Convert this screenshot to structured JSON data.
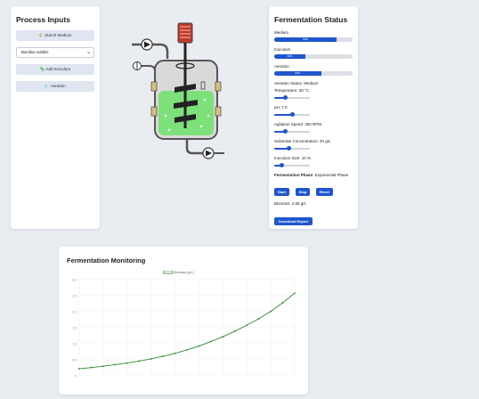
{
  "inputs": {
    "title": "Process Inputs",
    "starch_button": "Starch Medium",
    "starch_icon": "🌾",
    "organism_select": "Bacillus subtilis",
    "add_inoculum_button": "Add Inoculum",
    "inoculum_icon": "🦠",
    "aeration_button": "Aeration",
    "aeration_icon": "💨"
  },
  "status": {
    "title": "Fermentation Status",
    "medium_label": "Medium",
    "medium_value": "80%",
    "medium_level": 0.8,
    "inoculum_label": "Inoculum",
    "inoculum_value": "40%",
    "inoculum_level": 0.4,
    "aeration_label": "Aeration",
    "aeration_value": "60%",
    "aeration_level": 0.6,
    "aeration_status": "Aeration Status: Medium",
    "temperature_label": "Temperature: 30 °C",
    "temperature_level": 0.3,
    "ph_label": "pH: 7.0",
    "ph_level": 0.5,
    "agitation_label": "Agitation Speed: 300 RPM",
    "agitation_level": 0.3,
    "substrate_label": "Substrate Concentration: 20 g/L",
    "substrate_level": 0.4,
    "inoculum_size_label": "Inoculum Size: 10 %",
    "inoculum_size_level": 0.2,
    "phase_label": "Fermentation Phase:",
    "phase_value": "Exponential Phase",
    "start_button": "Start",
    "stop_button": "Stop",
    "reset_button": "Reset",
    "biomass_label": "Biomass: 2.58 g/L",
    "download_button": "Download Report"
  },
  "monitor": {
    "title": "Fermentation Monitoring"
  },
  "colors": {
    "accent": "#1f56d0",
    "liquid": "#7ee07a",
    "line": "#2e8b2e"
  },
  "chart_data": {
    "type": "line",
    "title": "",
    "legend": "Biomass (g/L)",
    "legend_position": "top-center",
    "xlabel": "",
    "ylabel": "",
    "ylim": [
      0,
      3.0
    ],
    "yticks": [
      "0",
      "0.5",
      "1.0",
      "1.5",
      "2.0",
      "2.5",
      "3.0"
    ],
    "grid": true,
    "series": [
      {
        "name": "Biomass (g/L)",
        "values": [
          0.22,
          0.26,
          0.3,
          0.35,
          0.4,
          0.46,
          0.53,
          0.61,
          0.7,
          0.81,
          0.93,
          1.07,
          1.22,
          1.39,
          1.58,
          1.78,
          2.01,
          2.28,
          2.58
        ]
      }
    ]
  }
}
